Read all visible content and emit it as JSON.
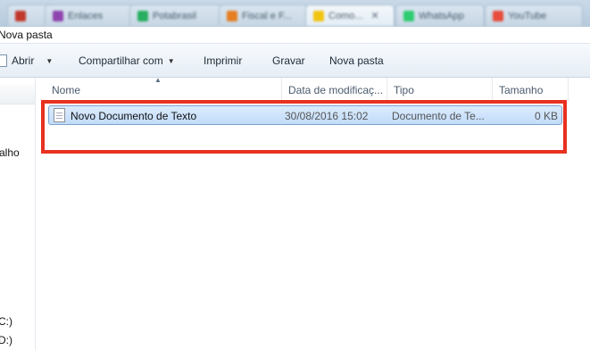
{
  "browser_tabs": [
    {
      "label": "",
      "icon_color": "#c0392b",
      "active": false
    },
    {
      "label": "Enlaces",
      "icon_color": "#8e44ad",
      "active": false
    },
    {
      "label": "Potabrasil",
      "icon_color": "#27ae60",
      "active": false
    },
    {
      "label": "Fiscal e F...",
      "icon_color": "#e67e22",
      "active": false
    },
    {
      "label": "Como...",
      "icon_color": "#f1c40f",
      "active": true
    },
    {
      "label": "WhatsApp",
      "icon_color": "#2ecc71",
      "active": false
    },
    {
      "label": "YouTube",
      "icon_color": "#e74c3c",
      "active": false
    }
  ],
  "window": {
    "title": "Nova pasta"
  },
  "toolbar": {
    "open_label": "Abrir",
    "share_label": "Compartilhar com",
    "print_label": "Imprimir",
    "burn_label": "Gravar",
    "new_folder_label": "Nova pasta"
  },
  "nav_pane": {
    "items": [
      "alho",
      "C:)",
      "D:)"
    ]
  },
  "columns": {
    "name": "Nome",
    "date": "Data de modificaç...",
    "type": "Tipo",
    "size": "Tamanho"
  },
  "files": [
    {
      "name": "Novo Documento de Texto",
      "date": "30/08/2016 15:02",
      "type": "Documento de Te...",
      "size": "0 KB",
      "icon": "text-document-icon",
      "selected": true
    }
  ],
  "colors": {
    "highlight": "#e8311f",
    "selection": "#c1dcfb"
  }
}
